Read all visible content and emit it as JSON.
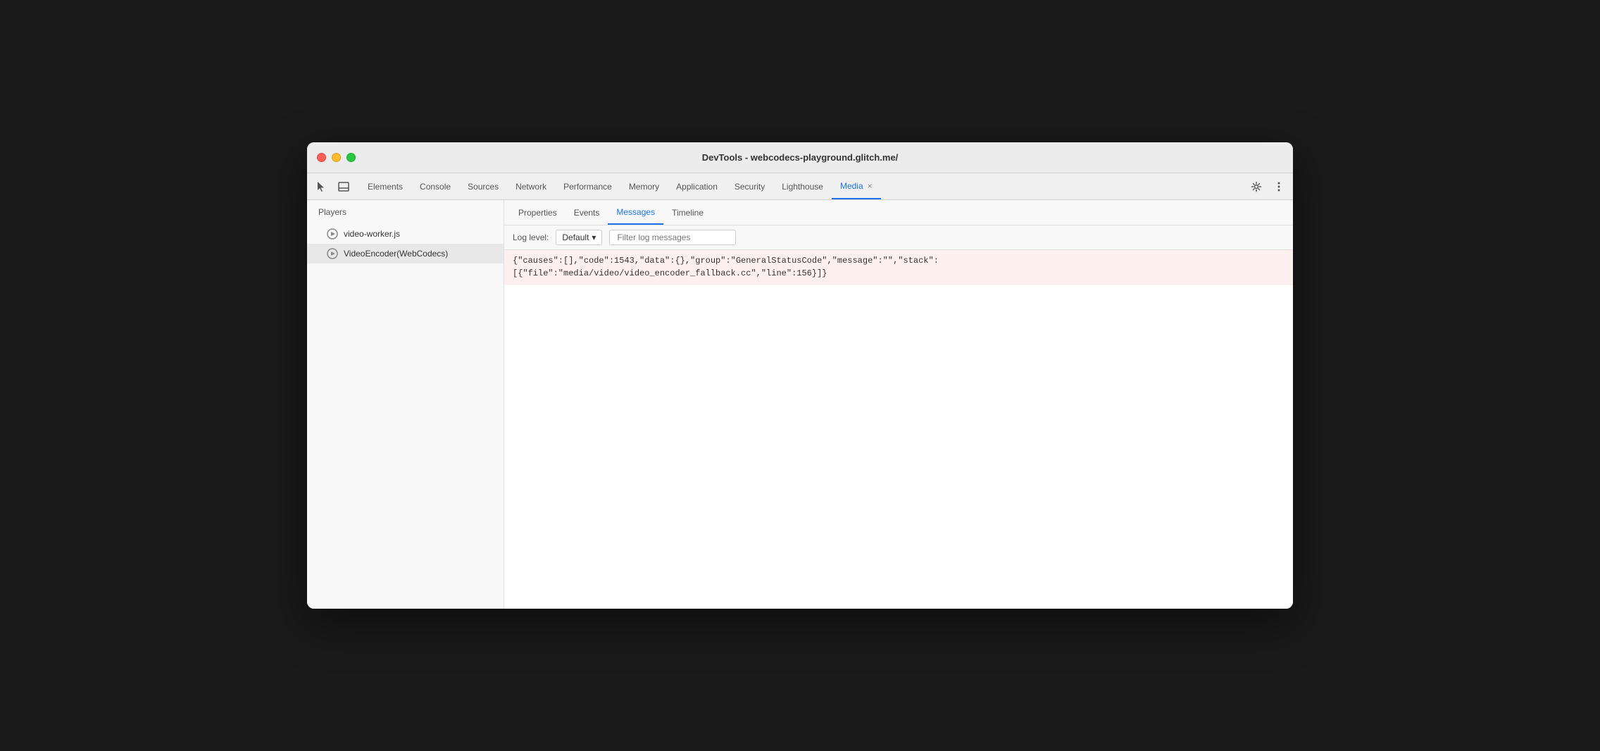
{
  "window": {
    "title": "DevTools - webcodecs-playground.glitch.me/"
  },
  "traffic_lights": {
    "close_label": "close",
    "minimize_label": "minimize",
    "maximize_label": "maximize"
  },
  "devtools_tabs": [
    {
      "id": "elements",
      "label": "Elements",
      "active": false
    },
    {
      "id": "console",
      "label": "Console",
      "active": false
    },
    {
      "id": "sources",
      "label": "Sources",
      "active": false
    },
    {
      "id": "network",
      "label": "Network",
      "active": false
    },
    {
      "id": "performance",
      "label": "Performance",
      "active": false
    },
    {
      "id": "memory",
      "label": "Memory",
      "active": false
    },
    {
      "id": "application",
      "label": "Application",
      "active": false
    },
    {
      "id": "security",
      "label": "Security",
      "active": false
    },
    {
      "id": "lighthouse",
      "label": "Lighthouse",
      "active": false
    },
    {
      "id": "media",
      "label": "Media",
      "active": true,
      "closeable": true
    }
  ],
  "sidebar": {
    "header": "Players",
    "items": [
      {
        "id": "video-worker",
        "label": "video-worker.js",
        "selected": false
      },
      {
        "id": "video-encoder",
        "label": "VideoEncoder(WebCodecs)",
        "selected": true
      }
    ]
  },
  "sub_tabs": [
    {
      "id": "properties",
      "label": "Properties",
      "active": false
    },
    {
      "id": "events",
      "label": "Events",
      "active": false
    },
    {
      "id": "messages",
      "label": "Messages",
      "active": true
    },
    {
      "id": "timeline",
      "label": "Timeline",
      "active": false
    }
  ],
  "log_bar": {
    "label": "Log level:",
    "level_value": "Default",
    "dropdown_icon": "▾",
    "filter_placeholder": "Filter log messages"
  },
  "messages": [
    {
      "id": "msg-1",
      "type": "error",
      "line1": "{\"causes\":[],\"code\":1543,\"data\":{},\"group\":\"GeneralStatusCode\",\"message\":\"\",\"stack\":",
      "line2": "[{\"file\":\"media/video/video_encoder_fallback.cc\",\"line\":156}]}"
    }
  ],
  "icons": {
    "cursor_tool": "↖",
    "drawer_toggle": "⬒",
    "settings": "⚙",
    "more": "⋮",
    "play_circle": "▶"
  }
}
